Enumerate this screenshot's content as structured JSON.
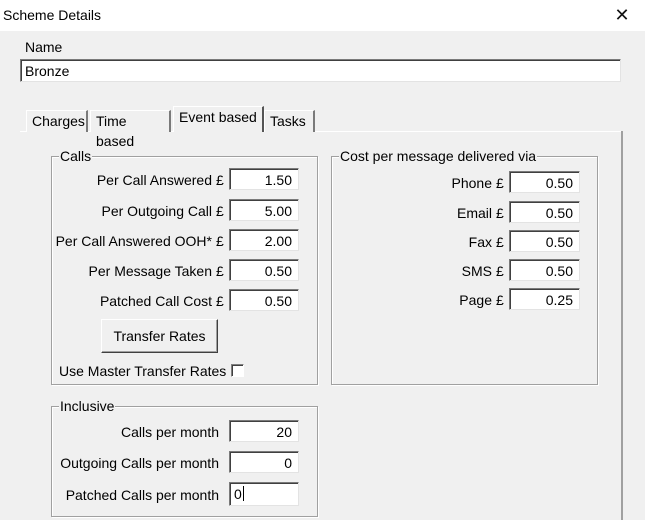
{
  "window": {
    "title": "Scheme Details",
    "close_glyph": "✕"
  },
  "name_field": {
    "label": "Name",
    "value": "Bronze"
  },
  "tabs": [
    {
      "label": "Charges",
      "active": false
    },
    {
      "label": "Time based",
      "active": false
    },
    {
      "label": "Event based",
      "active": true
    },
    {
      "label": "Tasks",
      "active": false
    }
  ],
  "calls": {
    "title": "Calls",
    "currency": "£",
    "rows": [
      {
        "label": "Per Call Answered",
        "value": "1.50"
      },
      {
        "label": "Per Outgoing Call",
        "value": "5.00"
      },
      {
        "label": "Per Call Answered OOH*",
        "value": "2.00"
      },
      {
        "label": "Per Message Taken",
        "value": "0.50"
      },
      {
        "label": "Patched Call Cost",
        "value": "0.50"
      }
    ],
    "transfer_button": "Transfer Rates",
    "master_rates_label": "Use Master Transfer Rates",
    "master_rates_checked": false
  },
  "cost_per_message": {
    "title": "Cost per message delivered via",
    "currency": "£",
    "rows": [
      {
        "label": "Phone",
        "value": "0.50"
      },
      {
        "label": "Email",
        "value": "0.50"
      },
      {
        "label": "Fax",
        "value": "0.50"
      },
      {
        "label": "SMS",
        "value": "0.50"
      },
      {
        "label": "Page",
        "value": "0.25"
      }
    ]
  },
  "inclusive": {
    "title": "Inclusive",
    "rows": [
      {
        "label": "Calls  per month",
        "value": "20"
      },
      {
        "label": "Outgoing Calls  per month",
        "value": "0"
      },
      {
        "label": "Patched Calls per month",
        "value": "0"
      }
    ]
  }
}
